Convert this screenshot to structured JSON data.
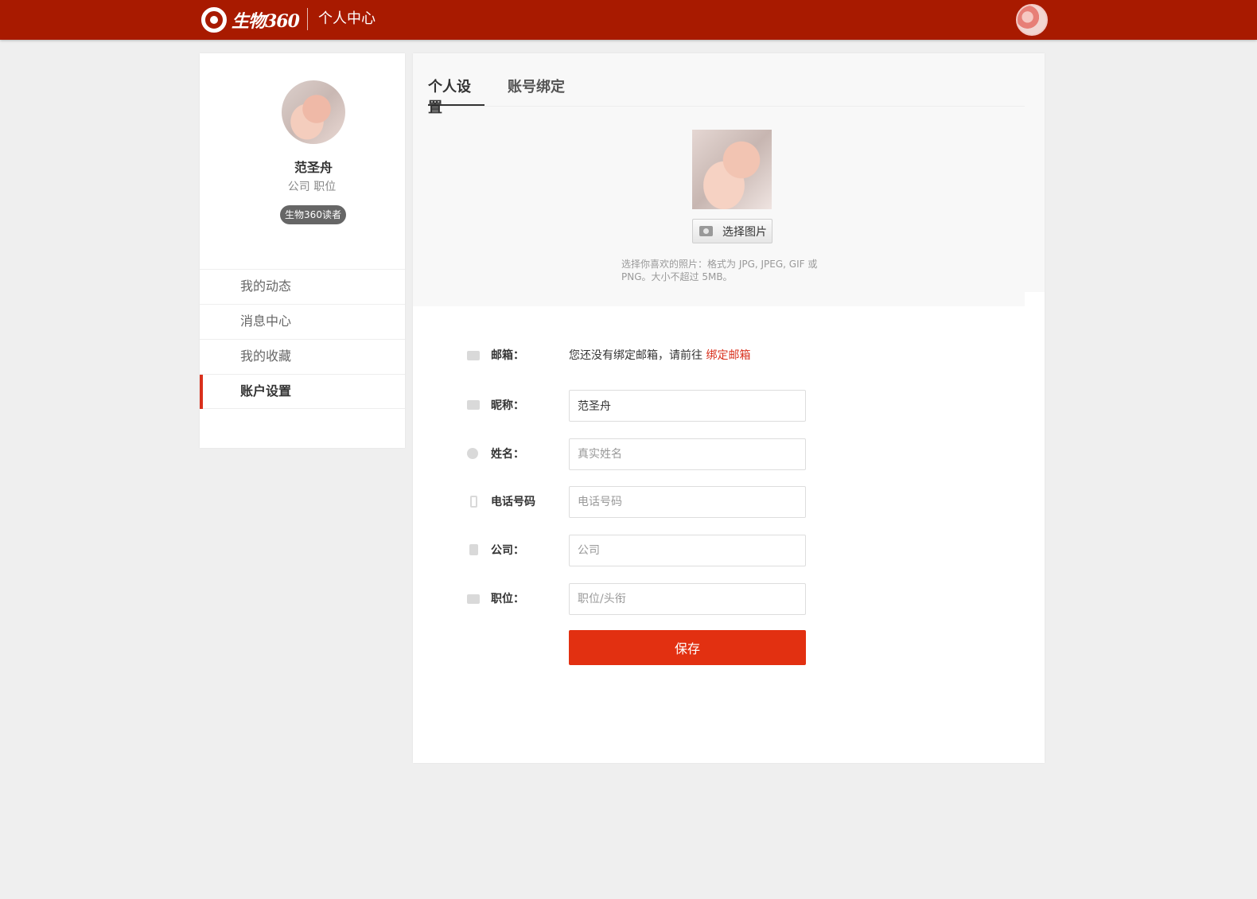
{
  "header": {
    "logo_text": "生物360",
    "title": "个人中心"
  },
  "profile": {
    "name": "范圣舟",
    "subtitle": "公司 职位",
    "badge": "生物360读者"
  },
  "nav": {
    "items": [
      {
        "label": "我的动态"
      },
      {
        "label": "消息中心"
      },
      {
        "label": "我的收藏"
      },
      {
        "label": "账户设置"
      }
    ],
    "active_index": 3
  },
  "tabs": [
    {
      "label": "个人设置"
    },
    {
      "label": "账号绑定"
    }
  ],
  "photo": {
    "choose_label": "选择图片",
    "hint": "选择你喜欢的照片：格式为 JPG, JPEG, GIF 或 PNG。大小不超过 5MB。"
  },
  "form": {
    "email": {
      "label": "邮箱：",
      "text": "您还没有绑定邮箱，请前往 ",
      "link": "绑定邮箱"
    },
    "nickname": {
      "label": "昵称：",
      "value": "范圣舟",
      "placeholder": ""
    },
    "realname": {
      "label": "姓名：",
      "value": "",
      "placeholder": "真实姓名"
    },
    "phone": {
      "label": "电话号码",
      "value": "",
      "placeholder": "电话号码"
    },
    "company": {
      "label": "公司：",
      "value": "",
      "placeholder": "公司"
    },
    "position": {
      "label": "职位：",
      "value": "",
      "placeholder": "职位/头衔"
    },
    "save_label": "保存"
  },
  "colors": {
    "header_bg": "#a81a00",
    "accent": "#e23011",
    "link": "#d9301c"
  },
  "icons": [
    "mail-icon",
    "list-icon",
    "user-icon",
    "phone-icon",
    "building-icon",
    "briefcase-icon",
    "camera-icon"
  ]
}
